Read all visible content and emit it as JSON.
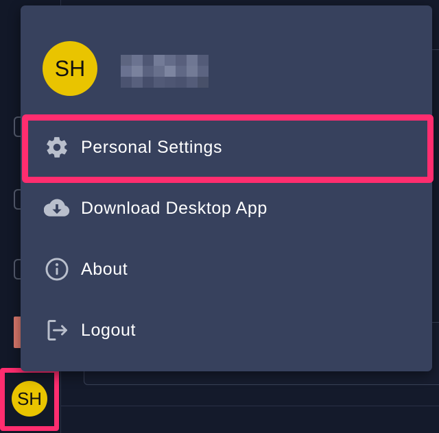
{
  "user": {
    "initials": "SH",
    "name_redacted": true
  },
  "menu": {
    "items": [
      {
        "label": "Personal Settings",
        "icon": "gear-icon"
      },
      {
        "label": "Download Desktop App",
        "icon": "cloud-download-icon"
      },
      {
        "label": "About",
        "icon": "info-icon"
      },
      {
        "label": "Logout",
        "icon": "logout-icon"
      }
    ]
  },
  "colors": {
    "highlight": "#ff2d6f",
    "avatar": "#e9c400",
    "menu_bg": "#37415d",
    "app_bg": "#141a2b",
    "icon": "#b9bfcc"
  }
}
